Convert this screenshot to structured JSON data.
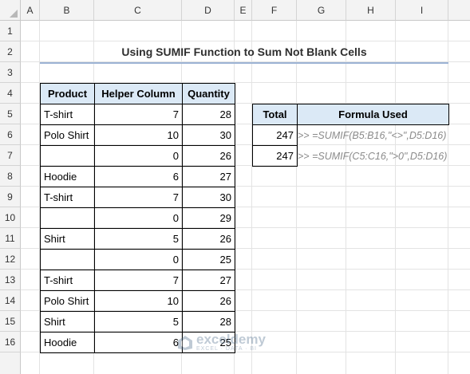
{
  "columns": [
    "A",
    "B",
    "C",
    "D",
    "E",
    "F",
    "G",
    "H",
    "I"
  ],
  "rows": [
    "1",
    "2",
    "3",
    "4",
    "5",
    "6",
    "7",
    "8",
    "9",
    "10",
    "11",
    "12",
    "13",
    "14",
    "15",
    "16"
  ],
  "title": "Using SUMIF Function to Sum Not Blank Cells",
  "table": {
    "headers": [
      "Product",
      "Helper Column",
      "Quantity"
    ],
    "rows": [
      [
        "T-shirt",
        "7",
        "28"
      ],
      [
        "Polo Shirt",
        "10",
        "30"
      ],
      [
        "",
        "0",
        "26"
      ],
      [
        "Hoodie",
        "6",
        "27"
      ],
      [
        "T-shirt",
        "7",
        "30"
      ],
      [
        "",
        "0",
        "29"
      ],
      [
        "Shirt",
        "5",
        "26"
      ],
      [
        "",
        "0",
        "25"
      ],
      [
        "T-shirt",
        "7",
        "27"
      ],
      [
        "Polo Shirt",
        "10",
        "26"
      ],
      [
        "Shirt",
        "5",
        "28"
      ],
      [
        "Hoodie",
        "6",
        "25"
      ]
    ]
  },
  "result": {
    "headers": [
      "Total",
      "Formula Used"
    ],
    "rows": [
      {
        "total": "247",
        "formula": ">> =SUMIF(B5:B16,\"<>\",D5:D16)"
      },
      {
        "total": "247",
        "formula": ">> =SUMIF(C5:C16,\">0\",D5:D16)"
      }
    ]
  },
  "watermark": {
    "name": "exceldemy",
    "sub": "EXCEL · DATA · BI"
  },
  "colors": {
    "header_fill": "#dbe9f6",
    "title_underline": "#9cb3d4",
    "grid": "#e3e3e3"
  }
}
